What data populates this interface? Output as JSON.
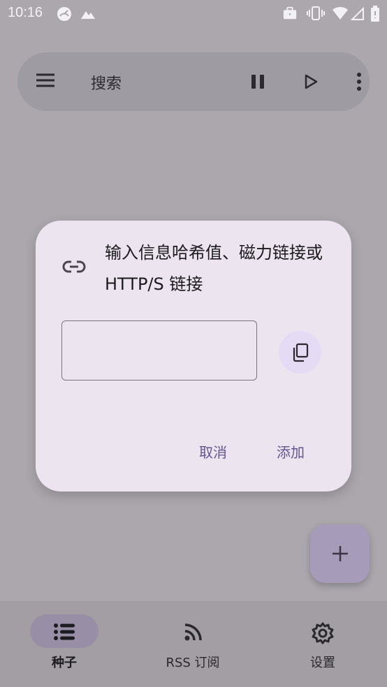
{
  "status_bar": {
    "time": "10:16"
  },
  "search_bar": {
    "placeholder": "搜索"
  },
  "dialog": {
    "title": "输入信息哈希值、磁力链接或 HTTP/S 链接",
    "input_value": "",
    "cancel_label": "取消",
    "add_label": "添加"
  },
  "bottom_nav": {
    "items": [
      {
        "label": "种子",
        "icon": "list-icon",
        "active": true
      },
      {
        "label": "RSS 订阅",
        "icon": "rss-icon",
        "active": false
      },
      {
        "label": "设置",
        "icon": "gear-icon",
        "active": false
      }
    ]
  },
  "colors": {
    "accent": "#65558f",
    "dialog_bg": "#ece5ef",
    "scrim_bg": "#aba7ad"
  }
}
